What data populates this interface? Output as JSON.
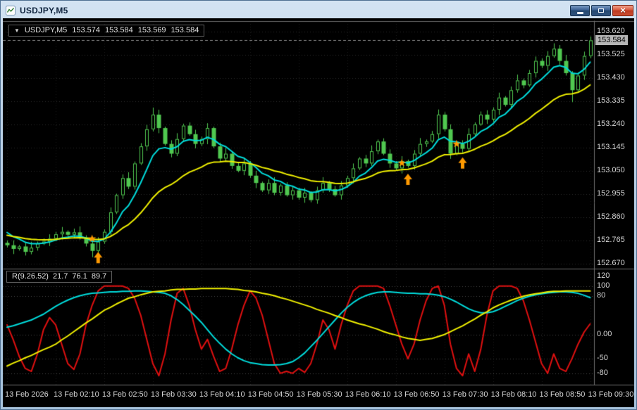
{
  "window": {
    "title": "USDJPY,M5",
    "controls": {
      "minimize_label": "Minimize",
      "restore_label": "Restore Down",
      "close_label": "Close",
      "close_glyph": "×"
    }
  },
  "chart": {
    "info": {
      "dropdown_icon": "▼",
      "symbol": "USDJPY,M5",
      "open": "153.574",
      "high": "153.584",
      "low": "153.569",
      "close": "153.584"
    },
    "indicator": {
      "name": "R(9.26.52)",
      "v1": "21.7",
      "v2": "76.1",
      "v3": "89.7"
    }
  },
  "colors": {
    "background": "#000000",
    "grid": "#2e2e2e",
    "vgrid": "#1d1d1d",
    "separator": "#6f6f6f",
    "candle": "#50c850",
    "current_line": "#8f8f8f",
    "level_line": "#4a4a4a"
  },
  "chart_data": {
    "type": "candlestick",
    "title": "USDJPY,M5",
    "main": {
      "ylim": [
        152.655,
        153.663
      ],
      "gridlines": [
        {
          "value": 153.62,
          "label": "153.620"
        },
        {
          "value": 153.525,
          "label": "153.525"
        },
        {
          "value": 153.43,
          "label": "153.430"
        },
        {
          "value": 153.335,
          "label": "153.335"
        },
        {
          "value": 153.24,
          "label": "153.240"
        },
        {
          "value": 153.145,
          "label": "153.145"
        },
        {
          "value": 153.05,
          "label": "153.050"
        },
        {
          "value": 152.955,
          "label": "152.955"
        },
        {
          "value": 152.86,
          "label": "152.860"
        },
        {
          "value": 152.765,
          "label": "152.765"
        },
        {
          "value": 152.67,
          "label": "152.670"
        }
      ],
      "current_price": {
        "value": 153.584,
        "label": "153.584"
      },
      "first_open": 152.755,
      "closes": [
        152.745,
        152.73,
        152.74,
        152.718,
        152.735,
        152.752,
        152.76,
        152.772,
        152.79,
        152.8,
        152.788,
        152.798,
        152.778,
        152.752,
        152.722,
        152.76,
        152.8,
        152.88,
        152.95,
        153.02,
        152.985,
        153.08,
        153.15,
        153.22,
        153.28,
        153.225,
        153.16,
        153.12,
        153.18,
        153.235,
        153.2,
        153.16,
        153.18,
        153.225,
        153.15,
        153.1,
        153.12,
        153.07,
        153.05,
        153.08,
        153.03,
        153.0,
        152.97,
        153.0,
        152.96,
        152.99,
        152.95,
        152.97,
        152.94,
        152.96,
        152.93,
        152.97,
        153.0,
        152.975,
        152.95,
        152.99,
        153.02,
        153.06,
        153.1,
        153.08,
        153.13,
        153.17,
        153.12,
        153.08,
        153.06,
        153.09,
        153.07,
        153.12,
        153.16,
        153.17,
        153.2,
        153.28,
        153.22,
        153.12,
        153.16,
        153.14,
        153.2,
        153.24,
        153.28,
        153.26,
        153.3,
        153.35,
        153.32,
        153.38,
        153.42,
        153.4,
        153.45,
        153.5,
        153.48,
        153.52,
        153.55,
        153.5,
        153.45,
        153.38,
        153.44,
        153.52,
        153.584
      ],
      "wick_high": [
        0.01,
        0.02,
        0.006,
        0.015,
        0.024,
        0.008,
        0.013,
        0.018
      ],
      "wick_low": [
        0.012,
        0.006,
        0.018,
        0.009,
        0.021,
        0.007,
        0.015,
        0.01
      ],
      "high_overrides": {
        "24": 153.309,
        "71": 153.301,
        "90": 153.572,
        "96": 153.6
      },
      "low_overrides": {
        "14": 152.696,
        "15": 152.7,
        "50": 152.921,
        "93": 153.331
      },
      "overlays": [
        {
          "name": "ma-fast",
          "color": "#00dcdc",
          "width": 2,
          "period": 7,
          "seed": 152.815
        },
        {
          "name": "ma-slow",
          "color": "#f0f000",
          "width": 2,
          "period": 22,
          "seed": 152.79
        }
      ],
      "arrows": {
        "color": "#ff9a00",
        "up": [
          {
            "index": 15,
            "price": 152.718
          },
          {
            "index": 66,
            "price": 153.038
          },
          {
            "index": 75,
            "price": 153.105
          }
        ],
        "stars": [
          {
            "index": 14,
            "price": 152.772
          },
          {
            "index": 65,
            "price": 153.082
          },
          {
            "index": 74,
            "price": 153.16
          }
        ]
      }
    },
    "oscillator": {
      "ylim": [
        -102,
        133
      ],
      "levels": [
        {
          "value": 120,
          "label": "120",
          "line": false
        },
        {
          "value": 100,
          "label": "100",
          "line": true
        },
        {
          "value": 80,
          "label": "80",
          "line": true
        },
        {
          "value": 0,
          "label": "0.00",
          "line": true
        },
        {
          "value": -50,
          "label": "-50",
          "line": true
        },
        {
          "value": -80,
          "label": "-80",
          "line": true
        }
      ],
      "series": [
        {
          "name": "fast",
          "color": "#e01010",
          "width": 2,
          "values": [
            20,
            -10,
            -45,
            -70,
            -76,
            -40,
            10,
            35,
            20,
            -20,
            -60,
            -72,
            -40,
            20,
            60,
            90,
            100,
            100,
            100,
            100,
            95,
            75,
            40,
            -10,
            -60,
            -85,
            -40,
            30,
            85,
            95,
            60,
            10,
            -30,
            -10,
            -45,
            -76,
            -70,
            -30,
            20,
            60,
            90,
            75,
            40,
            -10,
            -60,
            -80,
            -76,
            -80,
            -70,
            -78,
            -60,
            -20,
            30,
            10,
            -30,
            20,
            60,
            90,
            100,
            100,
            100,
            100,
            95,
            60,
            20,
            -20,
            -50,
            -20,
            30,
            70,
            95,
            100,
            60,
            -20,
            -70,
            -85,
            -40,
            -76,
            -30,
            40,
            90,
            100,
            100,
            100,
            95,
            70,
            30,
            -15,
            -60,
            -80,
            -40,
            -70,
            -76,
            -50,
            -20,
            5,
            22
          ]
        },
        {
          "name": "mid",
          "color": "#00dcdc",
          "width": 2,
          "values": [
            15,
            18,
            22,
            26,
            30,
            36,
            42,
            50,
            58,
            65,
            71,
            76,
            80,
            83,
            85,
            86,
            87,
            88,
            88,
            89,
            89,
            90,
            90,
            89,
            88,
            87,
            85,
            80,
            72,
            62,
            50,
            38,
            25,
            10,
            -5,
            -18,
            -30,
            -40,
            -48,
            -54,
            -58,
            -60,
            -62,
            -63,
            -63,
            -62,
            -60,
            -56,
            -48,
            -38,
            -25,
            -12,
            2,
            16,
            30,
            44,
            56,
            66,
            74,
            80,
            84,
            87,
            88,
            88,
            87,
            86,
            85,
            85,
            84,
            84,
            83,
            81,
            78,
            73,
            67,
            60,
            53,
            48,
            45,
            45,
            47,
            52,
            58,
            64,
            70,
            75,
            79,
            82,
            84,
            86,
            87,
            88,
            88,
            87,
            85,
            81,
            76
          ]
        },
        {
          "name": "slow",
          "color": "#f0f000",
          "width": 2,
          "values": [
            -65,
            -59,
            -54,
            -48,
            -43,
            -37,
            -31,
            -26,
            -20,
            -11,
            -3,
            6,
            15,
            24,
            32,
            41,
            50,
            56,
            63,
            69,
            75,
            78,
            82,
            85,
            88,
            89,
            90,
            92,
            93,
            93,
            94,
            94,
            95,
            95,
            95,
            95,
            95,
            94,
            93,
            91,
            90,
            88,
            85,
            83,
            80,
            76,
            73,
            69,
            65,
            61,
            57,
            52,
            48,
            44,
            39,
            35,
            30,
            26,
            22,
            19,
            15,
            11,
            6,
            2,
            -1,
            -5,
            -8,
            -10,
            -12,
            -10,
            -8,
            -4,
            0,
            6,
            12,
            18,
            25,
            32,
            40,
            47,
            55,
            61,
            66,
            71,
            75,
            79,
            82,
            84,
            86,
            88,
            89,
            89,
            90,
            90,
            90,
            90,
            90
          ]
        }
      ]
    },
    "time_axis": {
      "labels": [
        "13 Feb 2026",
        "13 Feb 02:10",
        "13 Feb 02:50",
        "13 Feb 03:30",
        "13 Feb 04:10",
        "13 Feb 04:50",
        "13 Feb 05:30",
        "13 Feb 06:10",
        "13 Feb 06:50",
        "13 Feb 07:30",
        "13 Feb 08:10",
        "13 Feb 08:50",
        "13 Feb 09:30"
      ],
      "indices": [
        0,
        8,
        16,
        24,
        32,
        40,
        48,
        56,
        64,
        72,
        80,
        88,
        96
      ]
    }
  }
}
